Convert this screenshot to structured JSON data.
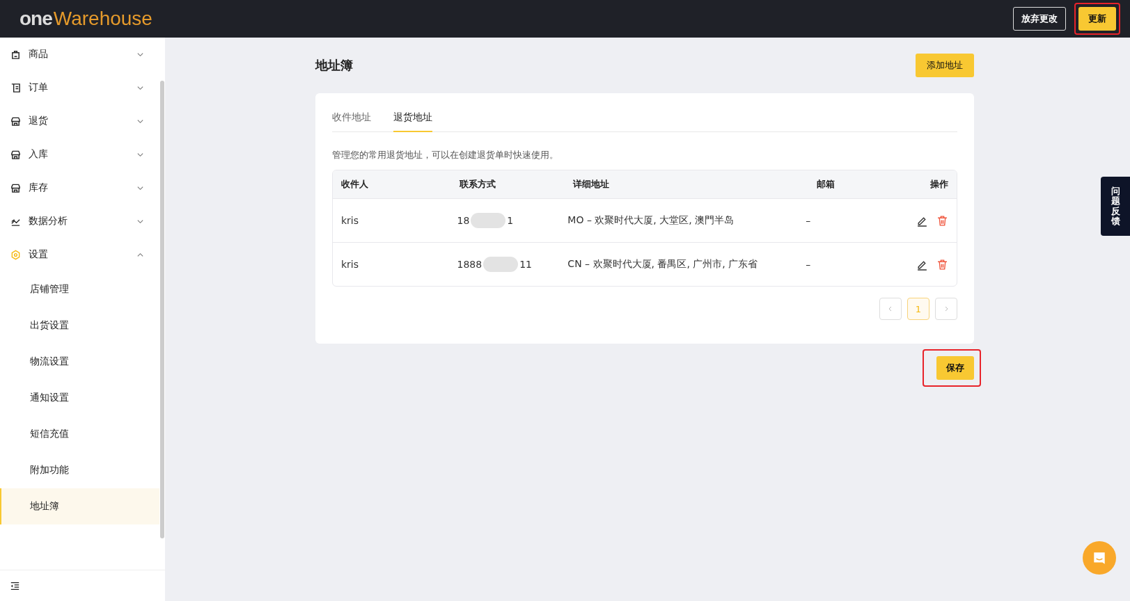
{
  "header": {
    "logo": {
      "part_1": "one",
      "part_2": "Warehouse"
    },
    "buttons": [
      {
        "label": "放弃更改",
        "kind": "outline"
      },
      {
        "label": "更新",
        "kind": "primary",
        "highlighted": true
      }
    ]
  },
  "sidebar": {
    "items": [
      {
        "label": "商品",
        "expanded": false
      },
      {
        "label": "订单",
        "expanded": false
      },
      {
        "label": "退货",
        "expanded": false
      },
      {
        "label": "入库",
        "expanded": false
      },
      {
        "label": "库存",
        "expanded": false
      },
      {
        "label": "数据分析",
        "expanded": false
      },
      {
        "label": "设置",
        "expanded": true,
        "children": [
          {
            "label": "店铺管理",
            "selected": false
          },
          {
            "label": "出货设置",
            "selected": false
          },
          {
            "label": "物流设置",
            "selected": false
          },
          {
            "label": "通知设置",
            "selected": false
          },
          {
            "label": "短信充值",
            "selected": false
          },
          {
            "label": "附加功能",
            "selected": false
          },
          {
            "label": "地址簿",
            "selected": true
          }
        ]
      }
    ]
  },
  "page": {
    "title": "地址簿",
    "add_button": "添加地址",
    "tabs": [
      {
        "label": "收件地址",
        "selected": false
      },
      {
        "label": "退货地址",
        "selected": true
      }
    ],
    "description": "管理您的常用退货地址，可以在创建退货单时快速使用。",
    "table": {
      "columns": [
        "收件人",
        "联系方式",
        "详细地址",
        "邮箱",
        "操作"
      ],
      "rows": [
        {
          "recipient": "kris",
          "phone_start": "18",
          "phone_end": "1",
          "address": "MO – 欢聚时代大厦, 大堂区, 澳門半岛",
          "email": "–"
        },
        {
          "recipient": "kris",
          "phone_start": "1888",
          "phone_end": "11",
          "address": "CN – 欢聚时代大厦, 番禺区, 广州市, 广东省",
          "email": "–"
        }
      ]
    },
    "pagination": {
      "pages": [
        {
          "label": "1",
          "selected": true
        }
      ]
    },
    "save_button": {
      "label": "保存",
      "highlighted": true
    }
  },
  "feedback_tab": "问题反馈"
}
